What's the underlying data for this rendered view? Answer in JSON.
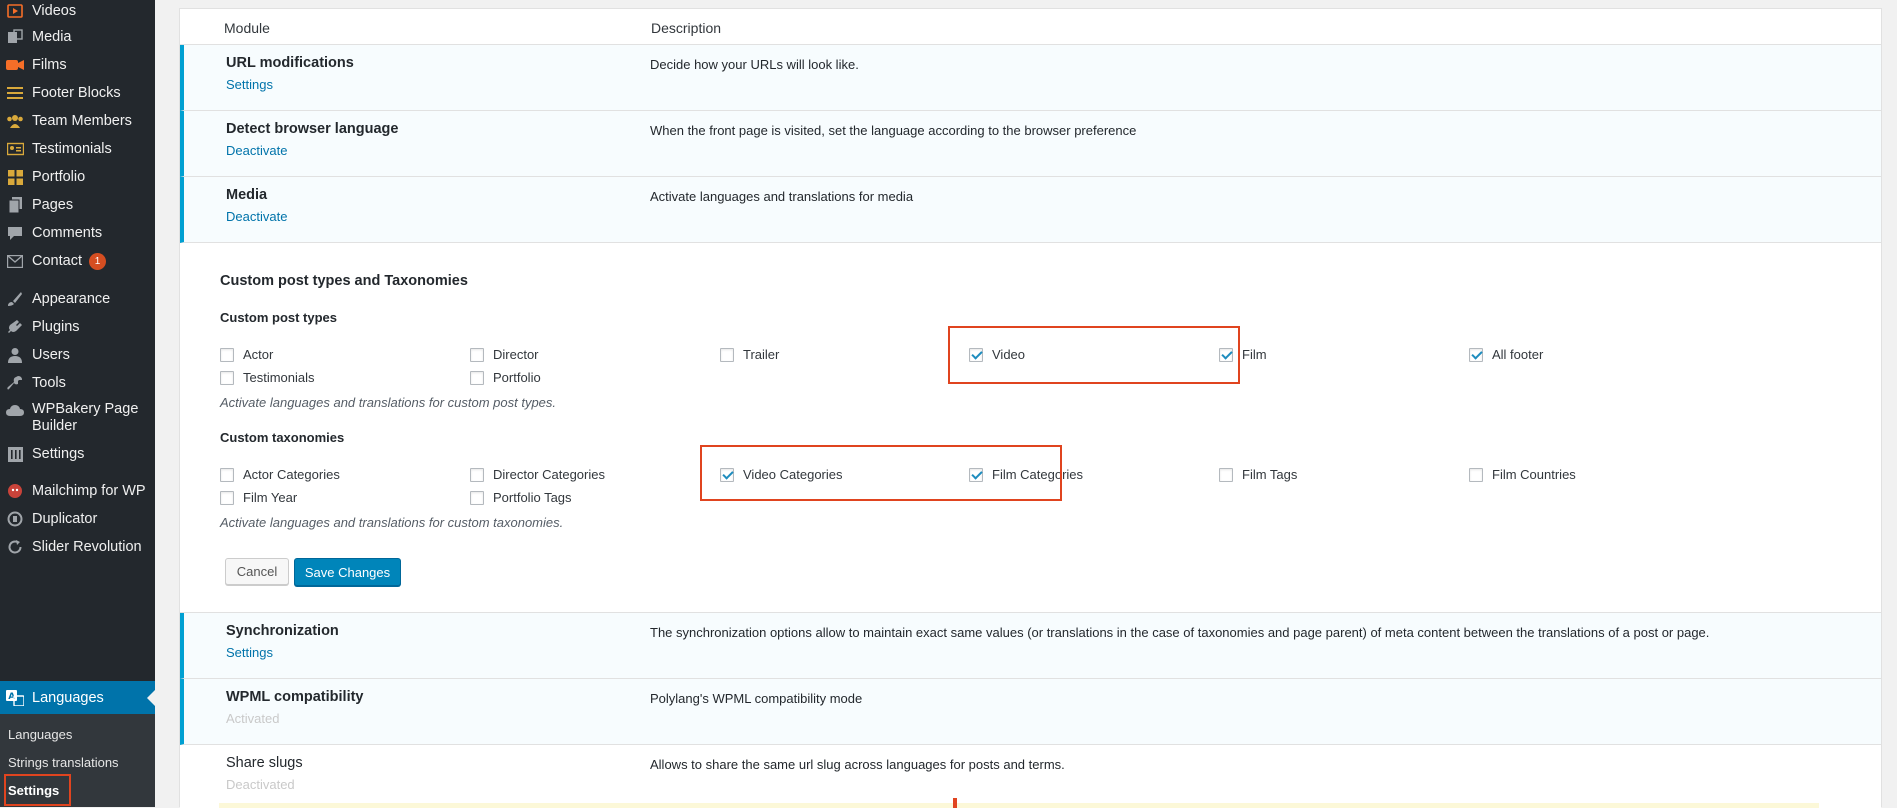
{
  "sidebar": {
    "items": [
      {
        "label": "Videos",
        "icon": "video-icon"
      },
      {
        "label": "Media",
        "icon": "media-icon"
      },
      {
        "label": "Films",
        "icon": "camera-icon"
      },
      {
        "label": "Footer Blocks",
        "icon": "menu-lines-icon"
      },
      {
        "label": "Team Members",
        "icon": "team-icon"
      },
      {
        "label": "Testimonials",
        "icon": "id-card-icon"
      },
      {
        "label": "Portfolio",
        "icon": "grid-icon"
      },
      {
        "label": "Pages",
        "icon": "pages-icon"
      },
      {
        "label": "Comments",
        "icon": "comment-icon"
      },
      {
        "label": "Contact",
        "icon": "mail-icon",
        "badge": "1"
      },
      {
        "label": "Appearance",
        "icon": "brush-icon"
      },
      {
        "label": "Plugins",
        "icon": "plugin-icon"
      },
      {
        "label": "Users",
        "icon": "user-icon"
      },
      {
        "label": "Tools",
        "icon": "wrench-icon"
      },
      {
        "label": "WPBakery Page Builder",
        "icon": "cloud-icon"
      },
      {
        "label": "Settings",
        "icon": "sliders-icon"
      },
      {
        "label": "Mailchimp for WP",
        "icon": "mailchimp-icon"
      },
      {
        "label": "Duplicator",
        "icon": "duplicator-icon"
      },
      {
        "label": "Slider Revolution",
        "icon": "refresh-icon"
      },
      {
        "label": "Languages",
        "icon": "translation-icon",
        "active": true
      }
    ],
    "submenu": [
      {
        "label": "Languages"
      },
      {
        "label": "Strings translations"
      },
      {
        "label": "Settings",
        "current": true
      }
    ]
  },
  "table": {
    "col_module": "Module",
    "col_description": "Description"
  },
  "modules": {
    "url": {
      "title": "URL modifications",
      "action": "Settings",
      "desc": "Decide how your URLs will look like."
    },
    "browser": {
      "title": "Detect browser language",
      "action": "Deactivate",
      "desc": "When the front page is visited, set the language according to the browser preference"
    },
    "media": {
      "title": "Media",
      "action": "Deactivate",
      "desc": "Activate languages and translations for media"
    },
    "sync": {
      "title": "Synchronization",
      "action": "Settings",
      "desc": "The synchronization options allow to maintain exact same values (or translations in the case of taxonomies and page parent) of meta content between the translations of a post or page."
    },
    "wpml": {
      "title": "WPML compatibility",
      "action": "Activated",
      "desc": "Polylang's WPML compatibility mode"
    },
    "slugs": {
      "title": "Share slugs",
      "action": "Deactivated",
      "desc": "Allows to share the same url slug across languages for posts and terms."
    }
  },
  "cpt": {
    "section_title": "Custom post types and Taxonomies",
    "post_types_title": "Custom post types",
    "post_types": [
      {
        "label": "Actor",
        "checked": false
      },
      {
        "label": "Director",
        "checked": false
      },
      {
        "label": "Trailer",
        "checked": false
      },
      {
        "label": "Video",
        "checked": true
      },
      {
        "label": "Film",
        "checked": true
      },
      {
        "label": "All footer",
        "checked": true
      },
      {
        "label": "Testimonials",
        "checked": false
      },
      {
        "label": "Portfolio",
        "checked": false
      }
    ],
    "post_types_hint": "Activate languages and translations for custom post types.",
    "taxonomies_title": "Custom taxonomies",
    "taxonomies": [
      {
        "label": "Actor Categories",
        "checked": false
      },
      {
        "label": "Director Categories",
        "checked": false
      },
      {
        "label": "Video Categories",
        "checked": true
      },
      {
        "label": "Film Categories",
        "checked": true
      },
      {
        "label": "Film Tags",
        "checked": false
      },
      {
        "label": "Film Countries",
        "checked": false
      },
      {
        "label": "Film Year",
        "checked": false
      },
      {
        "label": "Portfolio Tags",
        "checked": false
      }
    ],
    "taxonomies_hint": "Activate languages and translations for custom taxonomies.",
    "cancel_label": "Cancel",
    "save_label": "Save Changes"
  },
  "colors": {
    "sidebar_bg": "#23282d",
    "active_blue": "#0073aa",
    "accent_border": "#00a0d2",
    "highlight_red": "#e0441f",
    "primary_button": "#0085ba"
  }
}
